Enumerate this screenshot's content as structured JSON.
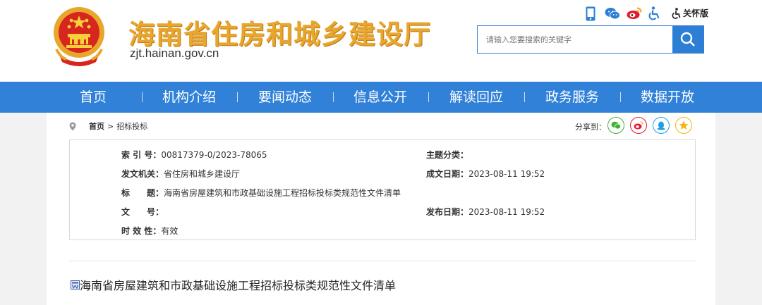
{
  "header": {
    "site_title": "海南省住房和城乡建设厅",
    "site_url": "zjt.hainan.gov.cn",
    "care_mode": "关怀版",
    "search_placeholder": "请输入您要搜索的关键字"
  },
  "nav": {
    "items": [
      "首页",
      "机构介绍",
      "要闻动态",
      "信息公开",
      "解读回应",
      "政务服务",
      "数据开放"
    ]
  },
  "breadcrumb": {
    "home": "首页",
    "separator": ">",
    "current": "招标投标"
  },
  "share": {
    "label": "分享到：",
    "targets": [
      "wechat-icon",
      "weibo-icon",
      "qq-icon",
      "qzone-icon"
    ]
  },
  "meta": {
    "index_label": "索 引 号：",
    "index_value": "00817379-0/2023-78065",
    "subject_label": "主题分类：",
    "subject_value": "",
    "issuer_label": "发文机关：",
    "issuer_value": "省住房和城乡建设厅",
    "created_label": "成文日期：",
    "created_value": "2023-08-11 19:52",
    "title_label": "标　　题：",
    "title_value": "海南省房屋建筑和市政基础设施工程招标投标类规范性文件清单",
    "docno_label": "文　　号：",
    "docno_value": "",
    "published_label": "发布日期：",
    "published_value": "2023-08-11 19:52",
    "validity_label": "时 效 性：",
    "validity_value": "有效"
  },
  "document": {
    "title": "海南省房屋建筑和市政基础设施工程招标投标类规范性文件清单"
  },
  "colors": {
    "nav_blue": "#3181d8",
    "title_gold": "#e8a72b",
    "emblem_red": "#d7261e",
    "wechat_green": "#3eb135",
    "weibo_red": "#e6162d",
    "qq_blue": "#1ea0e6",
    "qzone_yellow": "#f5b315"
  }
}
